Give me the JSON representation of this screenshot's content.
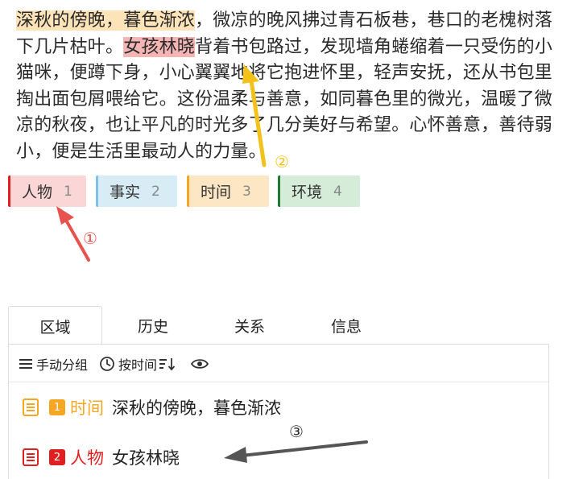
{
  "passage": {
    "highlight_time": "深秋的傍晚，暮色渐浓",
    "part1": "，微凉的晚风拂过青石板巷，巷口的老槐树落下几片枯叶。",
    "highlight_person": "女孩林晓",
    "part2": "背着书包路过，发现墙角蜷缩着一只受伤的小猫咪，便蹲下身，小心翼翼地将它抱进怀里，轻声安抚，还从书包里掏出面包屑喂给它。这份温柔与善意，如同暮色里的微光，温暖了微凉的秋夜，也让平凡的时光多了几分美好与希望。心怀善意，善待弱小，便是生活里最动人的力量。"
  },
  "tags": [
    {
      "label": "人物",
      "count": "1",
      "color": "#e02020"
    },
    {
      "label": "事实",
      "count": "2",
      "color": "#7cc3e6"
    },
    {
      "label": "时间",
      "count": "3",
      "color": "#f5a623"
    },
    {
      "label": "环境",
      "count": "4",
      "color": "#1f7a33"
    }
  ],
  "annotations": {
    "a1": "①",
    "a2": "②",
    "a3": "③"
  },
  "tabs": [
    {
      "label": "区域",
      "active": true
    },
    {
      "label": "历史"
    },
    {
      "label": "关系"
    },
    {
      "label": "信息"
    }
  ],
  "toolbar": {
    "group_label": "手动分组",
    "sort_label": "按时间",
    "group_icon": "menu-icon",
    "sort_icon": "clock-icon",
    "visibility_icon": "eye-icon"
  },
  "list": [
    {
      "badge": "1",
      "category": "时间",
      "text": "深秋的傍晚，暮色渐浓",
      "color": "#f5a623",
      "icon": "document-icon"
    },
    {
      "badge": "2",
      "category": "人物",
      "text": "女孩林晓",
      "color": "#e02020",
      "icon": "document-icon"
    }
  ]
}
